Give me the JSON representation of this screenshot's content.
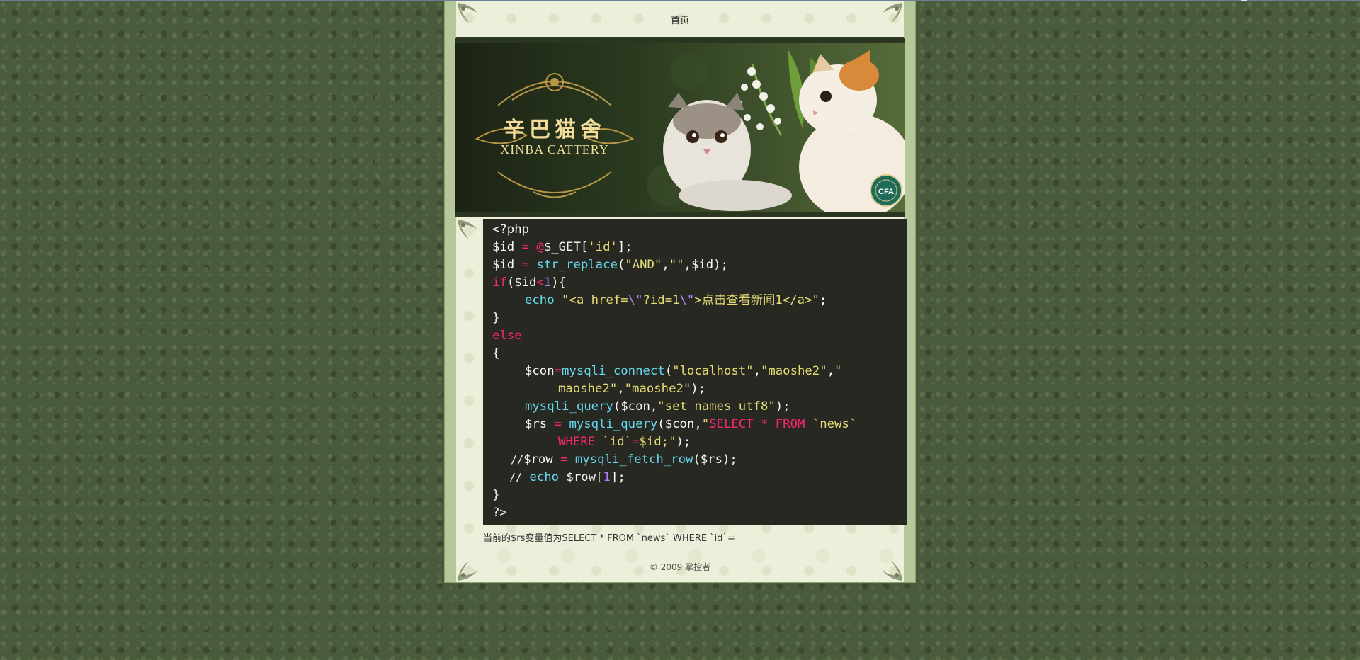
{
  "nav": {
    "home_label": "首页"
  },
  "banner": {
    "title_cn": "辛巴猫舍",
    "title_en": "XINBA CATTERY",
    "badge": "CFA"
  },
  "code": {
    "line1": "<?php",
    "line2": {
      "a": "$id ",
      "b": "=",
      "c": " ",
      "d": "@",
      "e": "$_GET[",
      "f": "'id'",
      "g": "];"
    },
    "line3": {
      "a": "$id ",
      "b": "=",
      "c": " ",
      "d": "str_replace",
      "e": "(",
      "f": "\"AND\"",
      "g": ",",
      "h": "\"\"",
      "i": ",$id);"
    },
    "line4": {
      "a": "if",
      "b": "($id",
      "c": "<",
      "d": "1",
      "e": "){"
    },
    "line5": {
      "a": "echo",
      "b": " ",
      "c": "\"<a href=",
      "d": "\\\"",
      "e": "?id=1",
      "f": "\\\"",
      "g": ">点击查看新闻1</a>\"",
      "h": ";"
    },
    "line6": "}",
    "line7": "else",
    "line8": "{",
    "line9": {
      "a": "$con",
      "b": "=",
      "c": "mysqli_connect",
      "d": "(",
      "e": "\"localhost\"",
      "f": ",",
      "g": "\"maoshe2\"",
      "h": ",",
      "i": "\""
    },
    "line10": {
      "a": "maoshe2\"",
      "b": ",",
      "c": "\"maoshe2\"",
      "d": ");"
    },
    "line11": {
      "a": "mysqli_query",
      "b": "($con,",
      "c": "\"set names utf8\"",
      "d": ");"
    },
    "line12": {
      "a": "$rs ",
      "b": "=",
      "c": " ",
      "d": "mysqli_query",
      "e": "($con,",
      "f": "\"",
      "g": "SELECT * FROM",
      "h": " `news`"
    },
    "line13": {
      "a": "WHERE",
      "b": " `id`",
      "c": "=",
      "d": "$id;\"",
      "e": ");"
    },
    "line14": {
      "a": "//",
      "b": "$row ",
      "c": "=",
      "d": " ",
      "e": "mysqli_fetch_row",
      "f": "($rs);"
    },
    "line15": {
      "a": "//",
      "b": " ",
      "c": "echo",
      "d": " $row[",
      "e": "1",
      "f": "];"
    },
    "line16": "}",
    "line17": "?>"
  },
  "result_text": "当前的$rs变量值为SELECT * FROM `news` WHERE `id`=",
  "footer": {
    "text": "© 2009 掌控者"
  }
}
